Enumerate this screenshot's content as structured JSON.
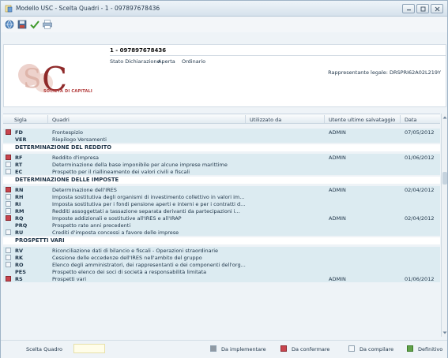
{
  "window": {
    "title": "Modello USC - Scelta Quadri - 1 - 097897678436"
  },
  "header": {
    "declaration_code": "1 - 097897678436",
    "status_label": "Stato Dichiarazione :",
    "status_value": "Aperta",
    "status_type": "Ordinario",
    "legal_representative": "Rappresentante legale: DRSPRI62A02L219Y",
    "logo_text": "SOCIETÀ DI CAPITALI"
  },
  "table": {
    "columns": {
      "sigla": "Sigla",
      "quadri": "Quadri",
      "utilizzato": "Utilizzato da",
      "utente": "Utente ultimo salvataggio",
      "data": "Data"
    },
    "rows": [
      {
        "type": "item",
        "tinted": true,
        "status": "red",
        "code": "FD",
        "desc": "Frontespizio",
        "user": "ADMIN",
        "date": "07/05/2012"
      },
      {
        "type": "item",
        "tinted": true,
        "status": "none",
        "code": "VER",
        "desc": "Riepilogo Versamenti",
        "user": "",
        "date": ""
      },
      {
        "type": "section",
        "title": "DETERMINAZIONE DEL REDDITO"
      },
      {
        "type": "item",
        "tinted": true,
        "status": "red",
        "code": "RF",
        "desc": "Reddito d'impresa",
        "user": "ADMIN",
        "date": "01/06/2012"
      },
      {
        "type": "item",
        "tinted": true,
        "status": "white",
        "code": "RT",
        "desc": "Determinazione della base imponibile per alcune imprese marittime",
        "user": "",
        "date": ""
      },
      {
        "type": "item",
        "tinted": true,
        "status": "white",
        "code": "EC",
        "desc": "Prospetto per il riallineamento dei valori civili e fiscali",
        "user": "",
        "date": ""
      },
      {
        "type": "section",
        "title": "DETERMINAZIONE DELLE IMPOSTE"
      },
      {
        "type": "item",
        "tinted": true,
        "status": "red",
        "code": "RN",
        "desc": "Determinazione dell'IRES",
        "user": "ADMIN",
        "date": "02/04/2012"
      },
      {
        "type": "item",
        "tinted": true,
        "status": "white",
        "code": "RH",
        "desc": "Imposta sostitutiva degli organismi di investimento collettivo in valori im...",
        "user": "",
        "date": ""
      },
      {
        "type": "item",
        "tinted": true,
        "status": "white",
        "code": "RI",
        "desc": "Imposta sostitutiva per i fondi pensione aperti e interni e per i contratti d...",
        "user": "",
        "date": ""
      },
      {
        "type": "item",
        "tinted": true,
        "status": "white",
        "code": "RM",
        "desc": "Redditi assoggettati a tassazione separata derivanti da partecipazioni i...",
        "user": "",
        "date": ""
      },
      {
        "type": "item",
        "tinted": true,
        "status": "red",
        "code": "RQ",
        "desc": "Imposte addizionali e sostitutive all'IRES e all'IRAP",
        "user": "ADMIN",
        "date": "02/04/2012"
      },
      {
        "type": "item",
        "tinted": true,
        "status": "none",
        "code": "PRQ",
        "desc": "Prospetto rate anni precedenti",
        "user": "",
        "date": ""
      },
      {
        "type": "item",
        "tinted": true,
        "status": "white",
        "code": "RU",
        "desc": "Crediti d'imposta concessi a favore delle imprese",
        "user": "",
        "date": ""
      },
      {
        "type": "section",
        "title": "PROSPETTI VARI"
      },
      {
        "type": "item",
        "tinted": true,
        "status": "white",
        "code": "RV",
        "desc": "Riconciliazione dati di bilancio e fiscali - Operazioni straordinarie",
        "user": "",
        "date": ""
      },
      {
        "type": "item",
        "tinted": true,
        "status": "white",
        "code": "RK",
        "desc": "Cessione delle eccedenze dell'IRES nell'ambito del gruppo",
        "user": "",
        "date": ""
      },
      {
        "type": "item",
        "tinted": true,
        "status": "white",
        "code": "RO",
        "desc": "Elenco degli amministratori, dei rappresentanti e dei componenti dell'org...",
        "user": "",
        "date": ""
      },
      {
        "type": "item",
        "tinted": true,
        "status": "none",
        "code": "PES",
        "desc": "Prospetto elenco dei soci di società a responsabilità limitata",
        "user": "",
        "date": ""
      },
      {
        "type": "item",
        "tinted": true,
        "status": "red",
        "code": "RS",
        "desc": "Prospetti vari",
        "user": "ADMIN",
        "date": "01/06/2012"
      }
    ]
  },
  "footer": {
    "search_label": "Scelta Quadro",
    "search_value": "",
    "legend": [
      "Da implementare",
      "Da confermare",
      "Da compilare",
      "Definitivo"
    ]
  },
  "colors": {
    "status_red": "#c8444d",
    "status_green": "#62a24a",
    "status_gray": "#8f99a3",
    "row_tint": "#dcebf1"
  },
  "icons": {
    "app": "app-document-icon",
    "toolbar": [
      "globe-icon",
      "save-icon",
      "checkmark-icon",
      "print-icon"
    ]
  }
}
